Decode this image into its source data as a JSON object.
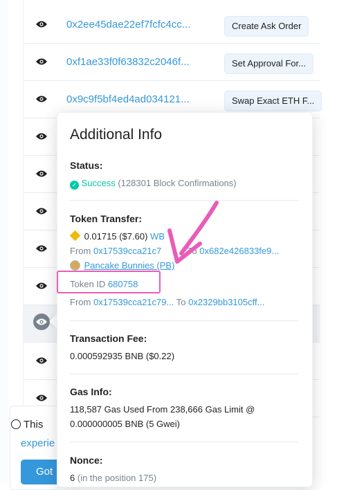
{
  "transactions": [
    {
      "hash": "0x2ee45dae22ef7fcfc4cc...",
      "method": "Create Ask Order"
    },
    {
      "hash": "0xf1ae33f0f63832c2046f...",
      "method": "Set Approval For..."
    },
    {
      "hash": "0x9c9f5bf4ed4ad034121...",
      "method": "Swap Exact ETH F..."
    },
    {
      "hash": "",
      "method": ""
    },
    {
      "hash": "",
      "method": ""
    },
    {
      "hash": "",
      "method": ""
    },
    {
      "hash": "",
      "method": ""
    },
    {
      "hash": "",
      "method": ""
    },
    {
      "hash": "",
      "method": ""
    },
    {
      "hash": "",
      "method": ""
    },
    {
      "hash": "",
      "method": ""
    }
  ],
  "popover": {
    "title": "Additional Info",
    "status": {
      "label": "Status:",
      "value": "Success",
      "confirmations": "(128301 Block Confirmations)"
    },
    "token_transfer": {
      "label": "Token Transfer:",
      "amount": "0.01715 ($7.60)",
      "token": "WB",
      "from1_label": "From",
      "from1": "0x17539cca21c7",
      "to1_label": "To",
      "to1": "0x682e426833fe9...",
      "nft_name": "Pancake Bunnies (PB)",
      "token_id_label": "Token ID",
      "token_id": "680758",
      "from2_label": "From",
      "from2": "0x17539cca21c79...",
      "to2_label": "To",
      "to2": "0x2329bb3105cff..."
    },
    "fee": {
      "label": "Transaction Fee:",
      "value": "0.000592935 BNB ($0.22)"
    },
    "gas": {
      "label": "Gas Info:",
      "line1": "118,587 Gas Used From 238,666 Gas Limit @",
      "line2": "0.000000005 BNB (5 Gwei)"
    },
    "nonce": {
      "label": "Nonce:",
      "value": "6",
      "position": "(in the position 175)"
    }
  },
  "cookie": {
    "text1": "This",
    "text2": "experie",
    "button": "Got"
  },
  "colors": {
    "link": "#3498db",
    "success": "#00c9a7",
    "bnb": "#f0b90b",
    "highlight": "#e85db8"
  }
}
